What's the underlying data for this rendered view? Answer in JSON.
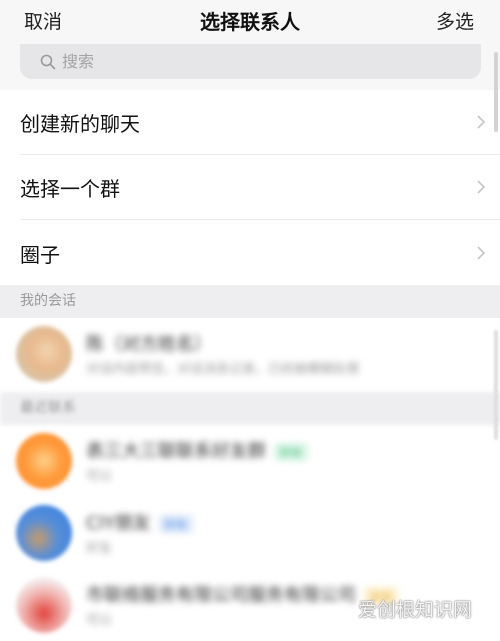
{
  "header": {
    "cancel_label": "取消",
    "title": "选择联系人",
    "multi_select_label": "多选"
  },
  "search": {
    "placeholder": "搜索"
  },
  "menu": {
    "items": [
      {
        "label": "创建新的聊天"
      },
      {
        "label": "选择一个群"
      },
      {
        "label": "圈子"
      }
    ]
  },
  "sections": {
    "my_chats": "我的会话",
    "recent": "最近联系"
  },
  "contacts": [
    {
      "name": "陈（对方姓名）",
      "sub": "对话内容预览，对话消息记录，已经被模糊处理"
    },
    {
      "name": "表三大三联联系好友群",
      "tag": "好友",
      "sub": "可以"
    },
    {
      "name": "CIY朋友",
      "tag": "好友",
      "sub": "好友"
    },
    {
      "name": "市联络服务有限公司服务有限公司",
      "tag": "企业",
      "sub": "可以"
    }
  ],
  "colors": {
    "header_bg": "#f7f7f7",
    "section_bg": "#eeeef0",
    "search_bg": "#e6e6e8"
  },
  "watermark": "爱创根知识网"
}
